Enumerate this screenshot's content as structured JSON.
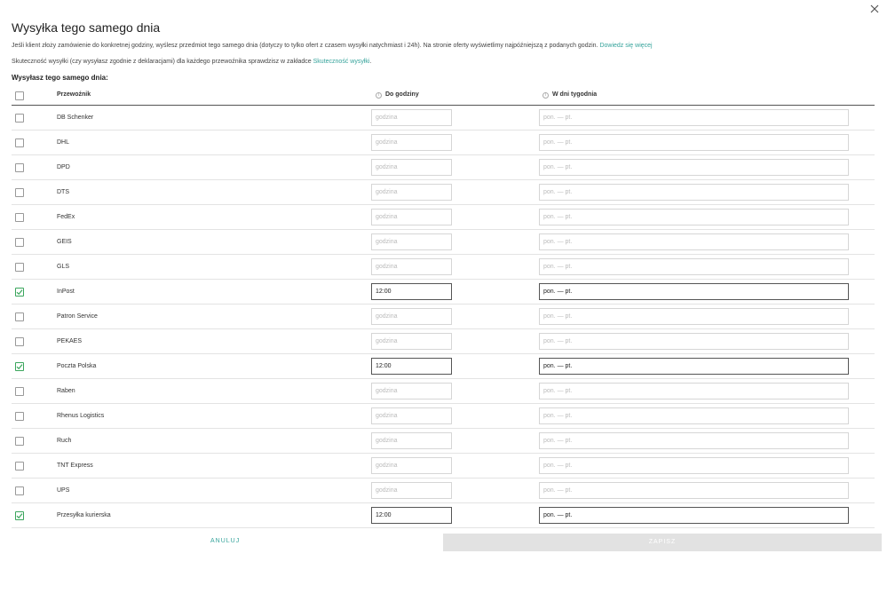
{
  "dialog": {
    "title": "Wysyłka tego samego dnia",
    "description": "Jeśli klient złoży zamówienie do konkretnej godziny, wyślesz przedmiot tego samego dnia (dotyczy to tylko ofert z czasem wysyłki natychmiast i 24h). Na stronie oferty wyświetlimy najpóźniejszą z podanych godzin.",
    "learn_more_link": "Dowiedz się więcej",
    "effectiveness_text": "Skuteczność wysyłki (czy wysyłasz zgodnie z deklaracjami) dla każdego przewoźnika sprawdzisz w zakładce",
    "effectiveness_link": "Skuteczność wysyłki",
    "effectiveness_suffix": ".",
    "subheading": "Wysyłasz tego samego dnia:",
    "close_icon": "close-icon"
  },
  "table": {
    "headers": {
      "carrier": "Przewoźnik",
      "hour": "Do godziny",
      "days": "W dni tygodnia"
    },
    "hour_placeholder": "godzina",
    "days_placeholder": "pon. — pt.",
    "rows": [
      {
        "carrier": "DB Schenker",
        "checked": false,
        "hour": "",
        "days": ""
      },
      {
        "carrier": "DHL",
        "checked": false,
        "hour": "",
        "days": ""
      },
      {
        "carrier": "DPD",
        "checked": false,
        "hour": "",
        "days": ""
      },
      {
        "carrier": "DTS",
        "checked": false,
        "hour": "",
        "days": ""
      },
      {
        "carrier": "FedEx",
        "checked": false,
        "hour": "",
        "days": ""
      },
      {
        "carrier": "GEIS",
        "checked": false,
        "hour": "",
        "days": ""
      },
      {
        "carrier": "GLS",
        "checked": false,
        "hour": "",
        "days": ""
      },
      {
        "carrier": "InPost",
        "checked": true,
        "hour": "12:00",
        "days": "pon. — pt."
      },
      {
        "carrier": "Patron Service",
        "checked": false,
        "hour": "",
        "days": ""
      },
      {
        "carrier": "PEKAES",
        "checked": false,
        "hour": "",
        "days": ""
      },
      {
        "carrier": "Poczta Polska",
        "checked": true,
        "hour": "12:00",
        "days": "pon. — pt."
      },
      {
        "carrier": "Raben",
        "checked": false,
        "hour": "",
        "days": ""
      },
      {
        "carrier": "Rhenus Logistics",
        "checked": false,
        "hour": "",
        "days": ""
      },
      {
        "carrier": "Ruch",
        "checked": false,
        "hour": "",
        "days": ""
      },
      {
        "carrier": "TNT Express",
        "checked": false,
        "hour": "",
        "days": ""
      },
      {
        "carrier": "UPS",
        "checked": false,
        "hour": "",
        "days": ""
      },
      {
        "carrier": "Przesyłka kurierska",
        "checked": true,
        "hour": "12:00",
        "days": "pon. — pt."
      }
    ]
  },
  "footer": {
    "cancel_label": "ANULUJ",
    "save_label": "ZAPISZ"
  },
  "colors": {
    "accent": "#35a39b",
    "checkbox_checked": "#3aa55c",
    "save_disabled_bg": "#e2e2e2"
  }
}
